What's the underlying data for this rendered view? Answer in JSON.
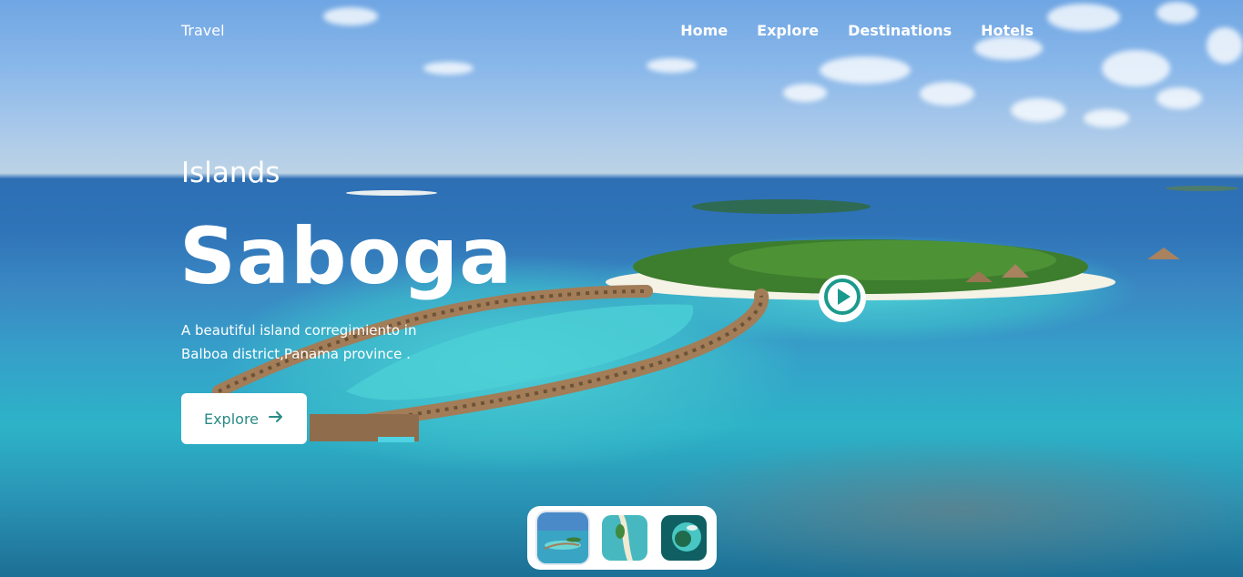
{
  "brand": "Travel",
  "nav": [
    "Home",
    "Explore",
    "Destinations",
    "Hotels"
  ],
  "hero": {
    "eyebrow": "Islands",
    "title": "Saboga",
    "description_line1": "A beautiful island corregimiento in",
    "description_line2": "Balboa district,Panama province .",
    "button_label": "Explore"
  },
  "icons": {
    "arrow": "arrow-right-icon",
    "play": "play-circle-icon"
  },
  "colors": {
    "accent": "#2b8b85",
    "white": "#ffffff"
  },
  "thumbnails": [
    {
      "name": "overwater-villas-thumbnail",
      "active": true
    },
    {
      "name": "sandbar-aerial-thumbnail",
      "active": false
    },
    {
      "name": "lagoon-aerial-thumbnail",
      "active": false
    }
  ]
}
